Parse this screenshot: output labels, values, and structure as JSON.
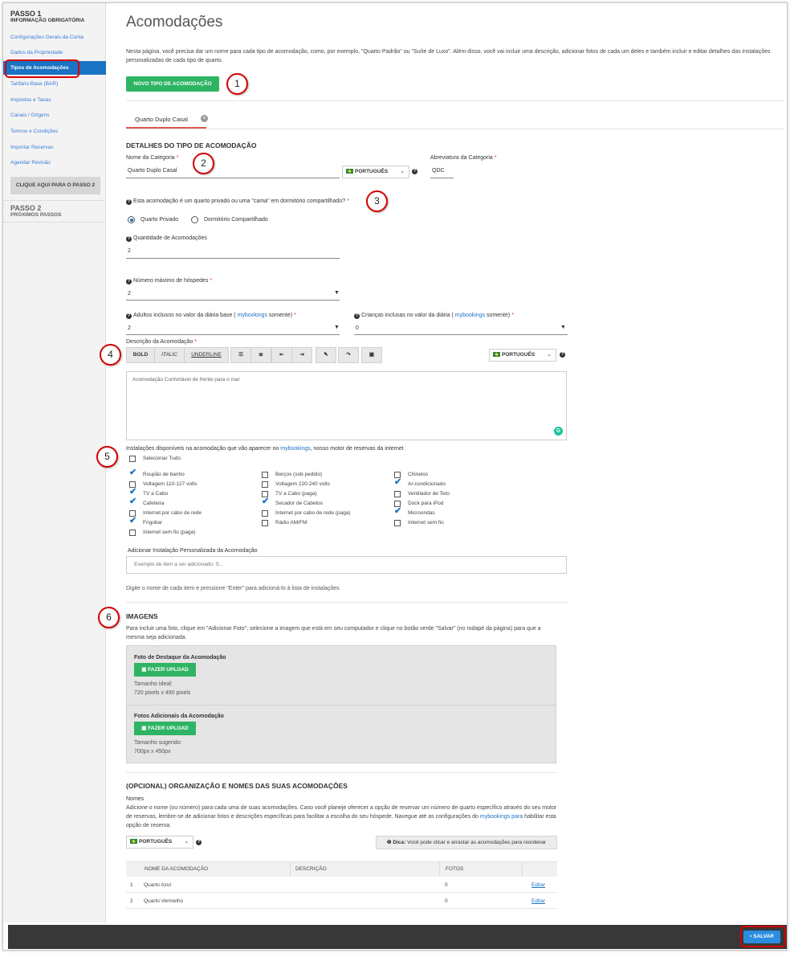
{
  "sidebar": {
    "step1_title": "PASSO 1",
    "step1_sub": "INFORMAÇÃO OBRIGATÓRIA",
    "items": [
      {
        "label": "Configurações Gerais da Conta"
      },
      {
        "label": "Dados da Propriedade"
      },
      {
        "label": "Tipos de Acomodações"
      },
      {
        "label": "Tarifário Base (BAR)"
      },
      {
        "label": "Impostos e Taxas"
      },
      {
        "label": "Canais / Origens"
      },
      {
        "label": "Termos e Condições"
      },
      {
        "label": "Importar Reservas"
      },
      {
        "label": "Agendar Revisão"
      }
    ],
    "step2_button": "CLIQUE AQUI PARA O PASSO 2",
    "step2_title": "PASSO 2",
    "step2_sub": "PRÓXIMOS PASSOS"
  },
  "callouts": [
    "1",
    "2",
    "3",
    "4",
    "5",
    "6"
  ],
  "main": {
    "title": "Acomodações",
    "intro": "Nesta página, você precisa dar um nome para cada tipo de acomodação, como, por exemplo, \"Quarto Padrão\" ou \"Suíte de Luxo\". Além disso, você vai incluir uma descrição, adicionar fotos de cada um deles e também incluir e editar detalhes das instalações personalizadas de cada tipo de quarto.",
    "new_button": "NOVO TIPO DE ACOMODAÇÃO",
    "tab_label": "Quarto Duplo Casal",
    "tab_close": "×",
    "details_title": "DETALHES DO TIPO DE ACOMODAÇÃO",
    "category_name_label": "Nome da Categoria",
    "category_name_value": "Quarto Duplo Casal",
    "language": "PORTUGUÊS",
    "abbrev_label": "Abreviatura da Categoria",
    "abbrev_value": "QDC",
    "required_mark": "*",
    "help_icon": "?",
    "private_question": "Esta acomodação é um quarto privado ou uma \"cama\" em dormitório compartilhado?",
    "radio_private": "Quarto Privado",
    "radio_shared": "Dormitório Compartilhado",
    "quantity_label": "Quantidade de Acomodações",
    "quantity_value": "2",
    "max_guests_label": "Número máximo de hóspedes",
    "max_guests_value": "2",
    "adults_label_pre": "Adultos inclusos no valor da diária base (",
    "adults_label_link": "mybookings",
    "adults_label_post": "somente)",
    "adults_value": "2",
    "children_label_pre": "Crianças inclusas no valor da diária (",
    "children_label_link": "mybookings",
    "children_label_post": "somente)",
    "children_value": "0",
    "description_label": "Descrição da Acomodação",
    "toolbar": {
      "bold": "BOLD",
      "italic": "ITALIC",
      "underline": "UNDERLINE"
    },
    "description_value": "Acomodação Confortável de frente para o mar",
    "amenities_label_pre": "Instalações disponíveis na acomodação que vão aparecer no",
    "amenities_label_link": "mybookings",
    "amenities_label_post": ", nosso motor de reservas da internet",
    "select_all": "Selecionar Tudo",
    "amenities_col1": [
      {
        "label": "Roupão de banho",
        "checked": true
      },
      {
        "label": "Voltagem 110-127 volts",
        "checked": false
      },
      {
        "label": "TV a Cabo",
        "checked": true
      },
      {
        "label": "Cafeteira",
        "checked": true
      },
      {
        "label": "Internet por cabo de rede",
        "checked": false
      },
      {
        "label": "Frigobar",
        "checked": true
      },
      {
        "label": "Internet sem fio (paga)",
        "checked": false
      }
    ],
    "amenities_col2": [
      {
        "label": "Berços (sob pedido)",
        "checked": false
      },
      {
        "label": "Voltagem 220-240 volts",
        "checked": false
      },
      {
        "label": "TV a Cabo (paga)",
        "checked": false
      },
      {
        "label": "Secador de Cabelos",
        "checked": true
      },
      {
        "label": "Internet por cabo de rede (paga)",
        "checked": false
      },
      {
        "label": "Rádio AM/FM",
        "checked": false
      }
    ],
    "amenities_col3": [
      {
        "label": "Chinelos",
        "checked": false
      },
      {
        "label": "Ar-condicionado",
        "checked": true
      },
      {
        "label": "Ventilador de Teto",
        "checked": false
      },
      {
        "label": "Dock para iPod",
        "checked": false
      },
      {
        "label": "Microondas",
        "checked": true
      },
      {
        "label": "Internet sem fio",
        "checked": false
      }
    ],
    "custom_amenity_label": "Adicionar Instalação Personalizada da Acomodação",
    "custom_amenity_placeholder": "Exemplo de item a ser adicionado: S...",
    "custom_amenity_hint": "Digite o nome de cada item e pressione \"Enter\" para adicioná-lo à lista de instalações",
    "images_title": "IMAGENS",
    "images_intro": "Para incluir uma foto, clique em \"Adicionar Foto\", selecione a imagem que está em seu computador e clique no botão verde \"Salvar\" (no rodapé da página) para que a mesma seja adicionada.",
    "featured_photo_label": "Foto de Destaque da Acomodação",
    "upload_button": "FAZER UPLOAD",
    "ideal_size_label": "Tamanho Ideal:",
    "ideal_size_value": "720 pixels x 490 pixels",
    "additional_photos_label": "Fotos Adicionais da Acomodação",
    "suggested_size_label": "Tamanho sugerido:",
    "suggested_size_value": "700px x 450px",
    "optional_title": "(OPCIONAL) ORGANIZAÇÃO E NOMES DAS SUAS ACOMODAÇÕES",
    "names_label": "Nomes",
    "names_intro_pre": "Adicione o nome (ou número) para cada uma de suas acomodações. Caso você planeje oferecer a opção de reservar um número de quarto específico através do seu motor de reservas, lembre-se de adicionar fotos e descrições específicas para facilitar a escolha do seu hóspede. Navegue até as configurações do",
    "names_intro_link": "mybookings para",
    "names_intro_post": "habilitar esta opção de reserva.",
    "tip_bold": "Dica:",
    "tip_text": "Você pode clicar e arrastar as acomodações para reordenar",
    "table_headers": [
      "NOME DA ACOMODAÇÃO",
      "DESCRIÇÃO",
      "FOTOS"
    ],
    "rooms": [
      {
        "num": "1",
        "name": "Quarto Azul",
        "desc": "",
        "photos": "0",
        "action": "Editar"
      },
      {
        "num": "2",
        "name": "Quarto Vermelho",
        "desc": "",
        "photos": "0",
        "action": "Editar"
      }
    ],
    "save_button": "SALVAR"
  }
}
